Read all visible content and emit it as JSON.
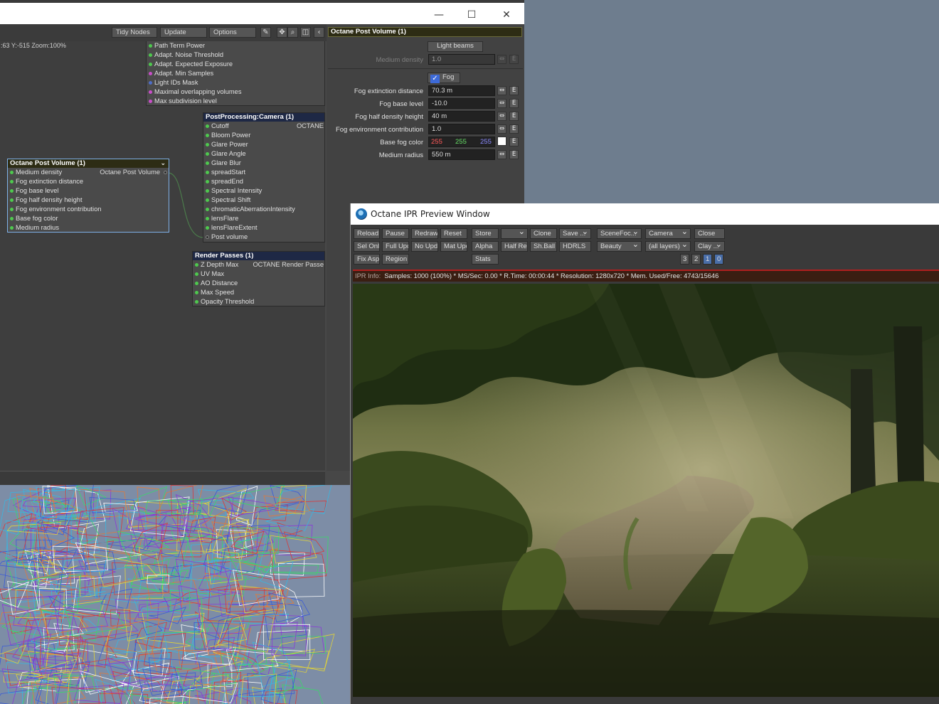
{
  "node_editor": {
    "window_controls": {
      "minimize": "—",
      "maximize": "☐",
      "close": "✕"
    },
    "toolbar": {
      "tidy_nodes": "Tidy Nodes",
      "update": "Update",
      "options": "Options",
      "icons": [
        "pin-icon",
        "move-icon",
        "zoom-icon",
        "split-view-icon",
        "collapse-left-icon"
      ]
    },
    "coords": ":63 Y:-515 Zoom:100%",
    "top_node": {
      "rows": [
        "Path Term Power",
        "Adapt. Noise Threshold",
        "Adapt. Expected Exposure",
        "Adapt. Min Samples",
        "Light IDs Mask",
        "Maximal overlapping volumes",
        "Max subdivision level"
      ]
    },
    "camera_node": {
      "title": "PostProcessing:Camera (1)",
      "right_label": "OCTANE",
      "rows": [
        "Cutoff",
        "Bloom Power",
        "Glare Power",
        "Glare Angle",
        "Glare Blur",
        "spreadStart",
        "spreadEnd",
        "Spectral Intensity",
        "Spectral Shift",
        "chromaticAberrationIntensity",
        "lensFlare",
        "lensFlareExtent",
        "Post volume"
      ]
    },
    "volume_node": {
      "title": "Octane Post Volume (1)",
      "output_label": "Octane Post Volume",
      "rows": [
        "Medium density",
        "Fog extinction distance",
        "Fog base level",
        "Fog half density height",
        "Fog environment contribution",
        "Base fog color",
        "Medium radius"
      ]
    },
    "passes_node": {
      "title": "Render Passes (1)",
      "right_label": "OCTANE Render Passe",
      "rows": [
        "Z Depth Max",
        "UV Max",
        "AO Distance",
        "Max Speed",
        "Opacity Threshold"
      ]
    }
  },
  "properties": {
    "title": "Octane Post Volume (1)",
    "light_beams_button": "Light beams",
    "medium_density": {
      "label": "Medium density",
      "value": "1.0"
    },
    "fog_checkbox": {
      "label": "Fog",
      "checked": true
    },
    "fields": [
      {
        "label": "Fog extinction distance",
        "value": "70.3 m"
      },
      {
        "label": "Fog base level",
        "value": "-10.0"
      },
      {
        "label": "Fog half density height",
        "value": "40 m"
      },
      {
        "label": "Fog environment contribution",
        "value": "1.0"
      }
    ],
    "base_fog_color": {
      "label": "Base fog color",
      "r": "255",
      "g": "255",
      "b": "255",
      "swatch": "#ffffff"
    },
    "medium_radius": {
      "label": "Medium radius",
      "value": "550 m"
    },
    "env_button": "E",
    "reset_icon": "reset-arrows-icon"
  },
  "ipr": {
    "title": "Octane IPR Preview Window",
    "row1": [
      "Reload",
      "Pause",
      "Redraw",
      "Reset",
      "Store",
      "",
      "Clone",
      "Save ...",
      "SceneFoc...",
      "Camera",
      "Close"
    ],
    "row2": [
      "Sel Only",
      "Full Upd.",
      "No Upd.",
      "Mat Upd",
      "Alpha",
      "Half Res",
      "Sh.Ball",
      "HDRLS",
      "Beauty",
      "(all layers)",
      "Clay ..."
    ],
    "row3": [
      "Fix Asp.",
      "Region",
      "Stats",
      "3",
      "2",
      "1",
      "0"
    ],
    "info": {
      "label": "IPR Info:",
      "text": "Samples: 1000 (100%)  *  MS/Sec: 0.00  *  R.Time: 00:00:44  *  Resolution: 1280x720  *  Mem. Used/Free: 4743/15646"
    }
  },
  "colors": {
    "accent_red": "#b01f1f",
    "node_header": "#1e2845",
    "prop_header": "#2d2c14",
    "rgb_r": "#ff5a5a",
    "rgb_g": "#66dd66",
    "rgb_b": "#8a8aff"
  }
}
